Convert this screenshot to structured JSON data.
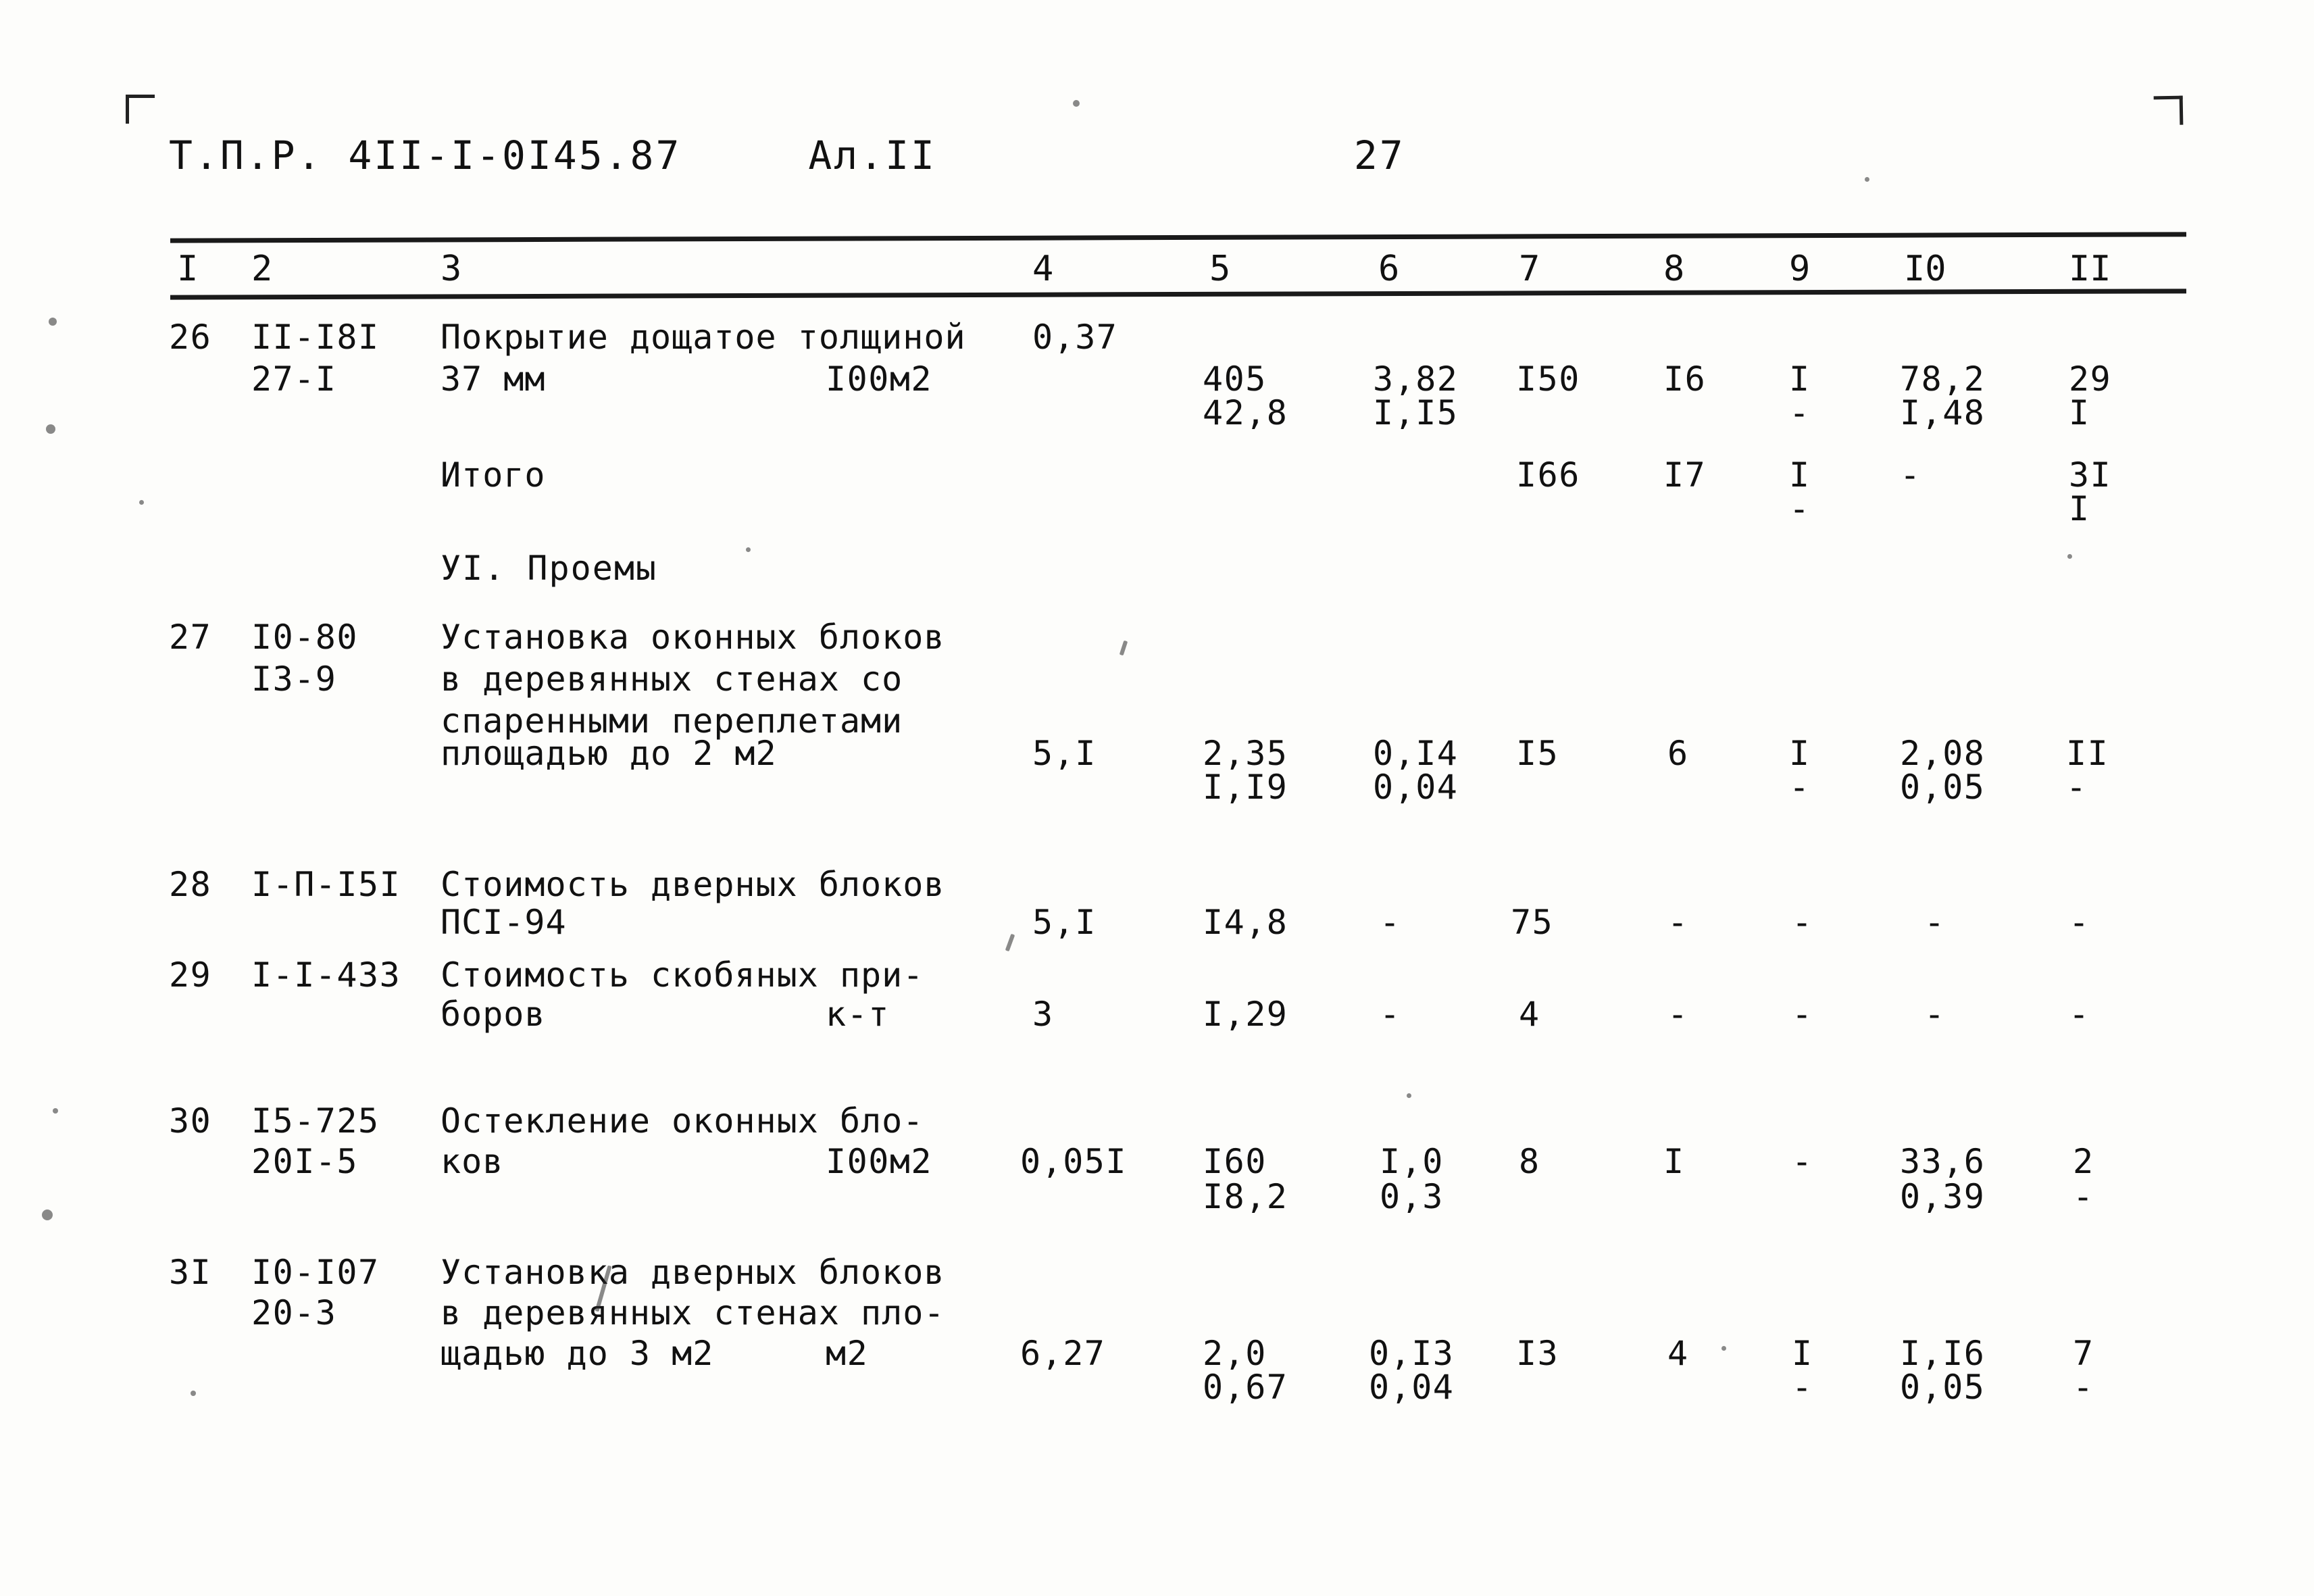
{
  "document": {
    "code": "Т.П.Р. 4II-I-0I45.87",
    "album": "Ал.II",
    "page_number": "27"
  },
  "table": {
    "column_headers": [
      "I",
      "2",
      "3",
      "4",
      "5",
      "6",
      "7",
      "8",
      "9",
      "I0",
      "II"
    ],
    "rows": [
      {
        "num": "26",
        "code_line1": "II-I8I",
        "code_line2": "27-I",
        "desc_line1": "Покрытие дощатое толщиной",
        "desc_line2": "37 мм",
        "unit": "I00м2",
        "c4": "0,37",
        "c5a": "405",
        "c5b": "42,8",
        "c6a": "3,82",
        "c6b": "I,I5",
        "c7a": "I50",
        "c7b": "",
        "c8a": "I6",
        "c8b": "",
        "c9a": "I",
        "c9b": "-",
        "c10a": "78,2",
        "c10b": "I,48",
        "c11a": "29",
        "c11b": "I"
      },
      {
        "num": "",
        "code_line1": "",
        "code_line2": "",
        "desc_line1": "Итого",
        "desc_line2": "",
        "unit": "",
        "c4": "",
        "c5a": "",
        "c5b": "",
        "c6a": "",
        "c6b": "",
        "c7a": "I66",
        "c7b": "",
        "c8a": "I7",
        "c8b": "",
        "c9a": "I",
        "c9b": "-",
        "c10a": "-",
        "c10b": "",
        "c11a": "3I",
        "c11b": "I"
      },
      {
        "num": "27",
        "code_line1": "I0-80",
        "code_line2": "I3-9",
        "desc_line1": "Установка оконных блоков",
        "desc_line2": "в деревянных стенах со",
        "desc_line3": "спаренными переплетами",
        "desc_line4": "площадью до 2 м2",
        "unit": "",
        "c4": "5,I",
        "c5a": "2,35",
        "c5b": "I,I9",
        "c6a": "0,I4",
        "c6b": "0,04",
        "c7a": "I5",
        "c7b": "",
        "c8a": "6",
        "c8b": "",
        "c9a": "I",
        "c9b": "-",
        "c10a": "2,08",
        "c10b": "0,05",
        "c11a": "II",
        "c11b": "-"
      },
      {
        "num": "28",
        "code_line1": "I-П-I5I",
        "code_line2": "",
        "desc_line1": "Стоимость дверных блоков",
        "desc_line2": "ПСI-94",
        "unit": "",
        "c4": "5,I",
        "c5a": "I4,8",
        "c5b": "",
        "c6a": "-",
        "c6b": "",
        "c7a": "75",
        "c7b": "",
        "c8a": "-",
        "c8b": "",
        "c9a": "-",
        "c9b": "",
        "c10a": "-",
        "c10b": "",
        "c11a": "-",
        "c11b": ""
      },
      {
        "num": "29",
        "code_line1": "I-I-433",
        "code_line2": "",
        "desc_line1": "Стоимость скобяных при-",
        "desc_line2": "боров",
        "unit": "к-т",
        "c4": "3",
        "c5a": "I,29",
        "c5b": "",
        "c6a": "-",
        "c6b": "",
        "c7a": "4",
        "c7b": "",
        "c8a": "-",
        "c8b": "",
        "c9a": "-",
        "c9b": "",
        "c10a": "-",
        "c10b": "",
        "c11a": "-",
        "c11b": ""
      },
      {
        "num": "30",
        "code_line1": "I5-725",
        "code_line2": "20I-5",
        "desc_line1": "Остекление оконных бло-",
        "desc_line2": "ков",
        "unit": "I00м2",
        "c4": "0,05I",
        "c5a": "I60",
        "c5b": "I8,2",
        "c6a": "I,0",
        "c6b": "0,3",
        "c7a": "8",
        "c7b": "",
        "c8a": "I",
        "c8b": "",
        "c9a": "-",
        "c9b": "",
        "c10a": "33,6",
        "c10b": "0,39",
        "c11a": "2",
        "c11b": "-"
      },
      {
        "num": "3I",
        "code_line1": "I0-I07",
        "code_line2": "20-3",
        "desc_line1": "Установка дверных блоков",
        "desc_line2": "в деревянных стенах пло-",
        "desc_line3": "щадью до 3 м2",
        "unit": "м2",
        "c4": "6,27",
        "c5a": "2,0",
        "c5b": "0,67",
        "c6a": "0,I3",
        "c6b": "0,04",
        "c7a": "I3",
        "c7b": "",
        "c8a": "4",
        "c8b": "",
        "c9a": "I",
        "c9b": "-",
        "c10a": "I,I6",
        "c10b": "0,05",
        "c11a": "7",
        "c11b": "-"
      }
    ],
    "section_heading": "УI. Проемы"
  }
}
